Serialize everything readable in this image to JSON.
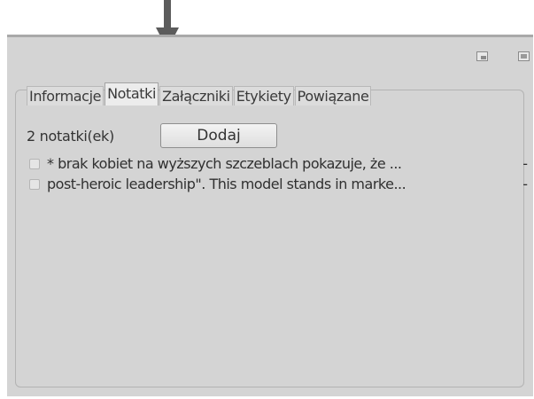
{
  "annotation": {
    "arrow": "down-arrow-icon"
  },
  "window": {
    "buttons": [
      "restore-icon",
      "close-icon"
    ]
  },
  "tabs": [
    {
      "label": "Informacje",
      "active": false
    },
    {
      "label": "Notatki",
      "active": true
    },
    {
      "label": "Załączniki",
      "active": false
    },
    {
      "label": "Etykiety",
      "active": false
    },
    {
      "label": "Powiązane",
      "active": false
    }
  ],
  "notes": {
    "count_label": "2 notatki(ek)",
    "add_button_label": "Dodaj",
    "items": [
      {
        "text": "* brak kobiet na wyższych szczeblach pokazuje, że ...",
        "remove": "-"
      },
      {
        "text": "post-heroic leadership\". This model stands in marke...",
        "remove": "-"
      }
    ]
  }
}
